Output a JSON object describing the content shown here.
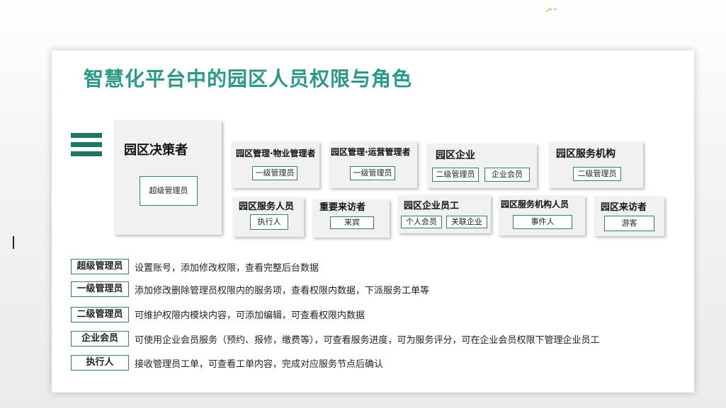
{
  "title": "智慧化平台中的园区人员权限与角色",
  "cards": [
    {
      "id": "decision",
      "title": "园区决策者",
      "tags": [
        "超级管理员"
      ]
    },
    {
      "id": "property",
      "title": "园区管理·物业管理者",
      "tags": [
        "一级管理员"
      ]
    },
    {
      "id": "operation",
      "title": "园区管理·运营管理者",
      "tags": [
        "一级管理员"
      ]
    },
    {
      "id": "enterprise",
      "title": "园区企业",
      "tags": [
        "二级管理员",
        "企业会员"
      ]
    },
    {
      "id": "service_org",
      "title": "园区服务机构",
      "tags": [
        "二级管理员"
      ]
    },
    {
      "id": "service_staff",
      "title": "园区服务人员",
      "tags": [
        "执行人"
      ]
    },
    {
      "id": "vip_visitor",
      "title": "重要来访者",
      "tags": [
        "来宾"
      ]
    },
    {
      "id": "employee",
      "title": "园区企业员工",
      "tags": [
        "个人会员",
        "关联企业"
      ]
    },
    {
      "id": "service_org_staff",
      "title": "园区服务机构人员",
      "tags": [
        "事件人"
      ]
    },
    {
      "id": "visitor",
      "title": "园区来访者",
      "tags": [
        "游客"
      ]
    }
  ],
  "roles": [
    {
      "label": "超级管理员",
      "desc": "设置账号，添加修改权限，查看完整后台数据"
    },
    {
      "label": "一级管理员",
      "desc": "添加修改删除管理员权限内的服务项，查看权限内数据，下派服务工单等"
    },
    {
      "label": "二级管理员",
      "desc": "可维护权限内模块内容，可添加编辑，可查看权限内数据"
    },
    {
      "label": "企业会员",
      "desc": "可使用企业会员服务（预约、报修，缴费等），可查看服务进度，可为服务评分，可在企业会员权限下管理企业员工"
    },
    {
      "label": "执行人",
      "desc": "接收管理员工单，可查看工单内容，完成对应服务节点后确认"
    }
  ],
  "colors": {
    "accent": "#2a9a86",
    "icon": "#1f7763",
    "tag_border": "#2e7e6c",
    "card_bg": "#f1f1f1"
  }
}
